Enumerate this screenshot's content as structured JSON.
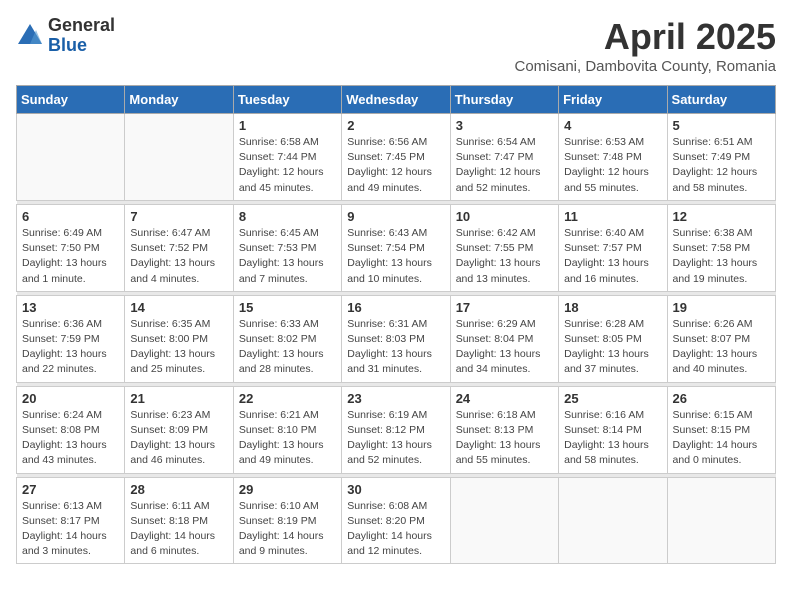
{
  "logo": {
    "general": "General",
    "blue": "Blue"
  },
  "header": {
    "month": "April 2025",
    "location": "Comisani, Dambovita County, Romania"
  },
  "weekdays": [
    "Sunday",
    "Monday",
    "Tuesday",
    "Wednesday",
    "Thursday",
    "Friday",
    "Saturday"
  ],
  "weeks": [
    [
      {
        "num": "",
        "detail": ""
      },
      {
        "num": "",
        "detail": ""
      },
      {
        "num": "1",
        "detail": "Sunrise: 6:58 AM\nSunset: 7:44 PM\nDaylight: 12 hours\nand 45 minutes."
      },
      {
        "num": "2",
        "detail": "Sunrise: 6:56 AM\nSunset: 7:45 PM\nDaylight: 12 hours\nand 49 minutes."
      },
      {
        "num": "3",
        "detail": "Sunrise: 6:54 AM\nSunset: 7:47 PM\nDaylight: 12 hours\nand 52 minutes."
      },
      {
        "num": "4",
        "detail": "Sunrise: 6:53 AM\nSunset: 7:48 PM\nDaylight: 12 hours\nand 55 minutes."
      },
      {
        "num": "5",
        "detail": "Sunrise: 6:51 AM\nSunset: 7:49 PM\nDaylight: 12 hours\nand 58 minutes."
      }
    ],
    [
      {
        "num": "6",
        "detail": "Sunrise: 6:49 AM\nSunset: 7:50 PM\nDaylight: 13 hours\nand 1 minute."
      },
      {
        "num": "7",
        "detail": "Sunrise: 6:47 AM\nSunset: 7:52 PM\nDaylight: 13 hours\nand 4 minutes."
      },
      {
        "num": "8",
        "detail": "Sunrise: 6:45 AM\nSunset: 7:53 PM\nDaylight: 13 hours\nand 7 minutes."
      },
      {
        "num": "9",
        "detail": "Sunrise: 6:43 AM\nSunset: 7:54 PM\nDaylight: 13 hours\nand 10 minutes."
      },
      {
        "num": "10",
        "detail": "Sunrise: 6:42 AM\nSunset: 7:55 PM\nDaylight: 13 hours\nand 13 minutes."
      },
      {
        "num": "11",
        "detail": "Sunrise: 6:40 AM\nSunset: 7:57 PM\nDaylight: 13 hours\nand 16 minutes."
      },
      {
        "num": "12",
        "detail": "Sunrise: 6:38 AM\nSunset: 7:58 PM\nDaylight: 13 hours\nand 19 minutes."
      }
    ],
    [
      {
        "num": "13",
        "detail": "Sunrise: 6:36 AM\nSunset: 7:59 PM\nDaylight: 13 hours\nand 22 minutes."
      },
      {
        "num": "14",
        "detail": "Sunrise: 6:35 AM\nSunset: 8:00 PM\nDaylight: 13 hours\nand 25 minutes."
      },
      {
        "num": "15",
        "detail": "Sunrise: 6:33 AM\nSunset: 8:02 PM\nDaylight: 13 hours\nand 28 minutes."
      },
      {
        "num": "16",
        "detail": "Sunrise: 6:31 AM\nSunset: 8:03 PM\nDaylight: 13 hours\nand 31 minutes."
      },
      {
        "num": "17",
        "detail": "Sunrise: 6:29 AM\nSunset: 8:04 PM\nDaylight: 13 hours\nand 34 minutes."
      },
      {
        "num": "18",
        "detail": "Sunrise: 6:28 AM\nSunset: 8:05 PM\nDaylight: 13 hours\nand 37 minutes."
      },
      {
        "num": "19",
        "detail": "Sunrise: 6:26 AM\nSunset: 8:07 PM\nDaylight: 13 hours\nand 40 minutes."
      }
    ],
    [
      {
        "num": "20",
        "detail": "Sunrise: 6:24 AM\nSunset: 8:08 PM\nDaylight: 13 hours\nand 43 minutes."
      },
      {
        "num": "21",
        "detail": "Sunrise: 6:23 AM\nSunset: 8:09 PM\nDaylight: 13 hours\nand 46 minutes."
      },
      {
        "num": "22",
        "detail": "Sunrise: 6:21 AM\nSunset: 8:10 PM\nDaylight: 13 hours\nand 49 minutes."
      },
      {
        "num": "23",
        "detail": "Sunrise: 6:19 AM\nSunset: 8:12 PM\nDaylight: 13 hours\nand 52 minutes."
      },
      {
        "num": "24",
        "detail": "Sunrise: 6:18 AM\nSunset: 8:13 PM\nDaylight: 13 hours\nand 55 minutes."
      },
      {
        "num": "25",
        "detail": "Sunrise: 6:16 AM\nSunset: 8:14 PM\nDaylight: 13 hours\nand 58 minutes."
      },
      {
        "num": "26",
        "detail": "Sunrise: 6:15 AM\nSunset: 8:15 PM\nDaylight: 14 hours\nand 0 minutes."
      }
    ],
    [
      {
        "num": "27",
        "detail": "Sunrise: 6:13 AM\nSunset: 8:17 PM\nDaylight: 14 hours\nand 3 minutes."
      },
      {
        "num": "28",
        "detail": "Sunrise: 6:11 AM\nSunset: 8:18 PM\nDaylight: 14 hours\nand 6 minutes."
      },
      {
        "num": "29",
        "detail": "Sunrise: 6:10 AM\nSunset: 8:19 PM\nDaylight: 14 hours\nand 9 minutes."
      },
      {
        "num": "30",
        "detail": "Sunrise: 6:08 AM\nSunset: 8:20 PM\nDaylight: 14 hours\nand 12 minutes."
      },
      {
        "num": "",
        "detail": ""
      },
      {
        "num": "",
        "detail": ""
      },
      {
        "num": "",
        "detail": ""
      }
    ]
  ]
}
